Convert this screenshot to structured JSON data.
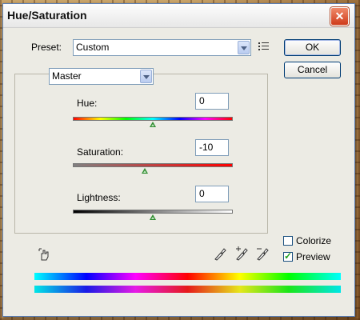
{
  "window": {
    "title": "Hue/Saturation",
    "close_glyph": "✕"
  },
  "preset": {
    "label": "Preset:",
    "value": "Custom",
    "menu_icon": "preset-options-icon"
  },
  "buttons": {
    "ok": "OK",
    "cancel": "Cancel"
  },
  "channel": {
    "value": "Master"
  },
  "sliders": {
    "hue": {
      "label": "Hue:",
      "value": "0",
      "position_fraction": 0.5
    },
    "saturation": {
      "label": "Saturation:",
      "value": "-10",
      "position_fraction": 0.45
    },
    "lightness": {
      "label": "Lightness:",
      "value": "0",
      "position_fraction": 0.5
    }
  },
  "options": {
    "colorize": {
      "label": "Colorize",
      "checked": false
    },
    "preview": {
      "label": "Preview",
      "checked": true
    }
  },
  "icons": {
    "hand_tool": "hand-adjust-icon",
    "eyedropper": "eyedropper-icon",
    "eyedropper_add": "eyedropper-plus-icon",
    "eyedropper_subtract": "eyedropper-minus-icon"
  },
  "colors": {
    "accent": "#2e8b2e",
    "frame": "#5a7fb8"
  }
}
